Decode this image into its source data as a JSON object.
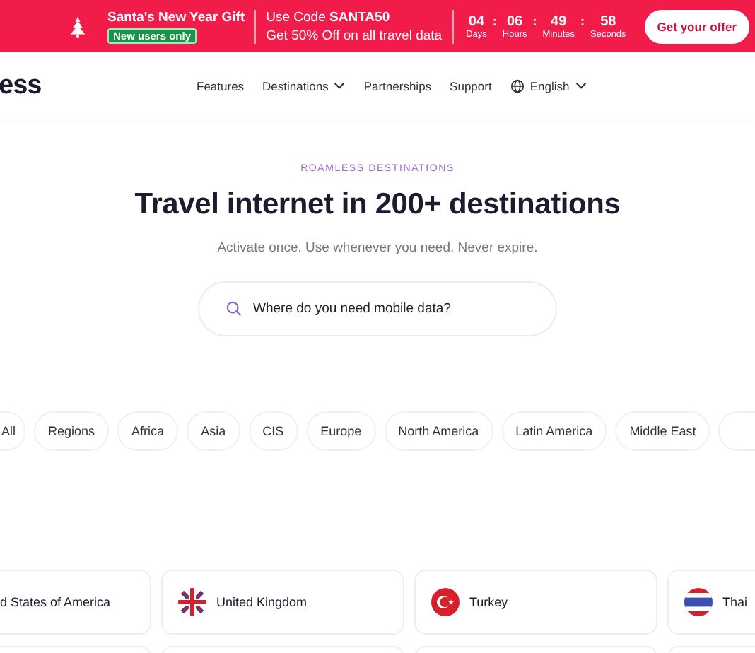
{
  "promo_banner": {
    "title": "Santa's New Year Gift",
    "badge": "New users only",
    "code_text": "Use Code **SANTA50**",
    "offer_text": "Get 50% Off on all travel data",
    "countdown": [
      {
        "value": "04",
        "unit": "Days"
      },
      {
        "value": "06",
        "unit": "Hours"
      },
      {
        "value": "49",
        "unit": "Minutes"
      },
      {
        "value": "58",
        "unit": "Seconds"
      }
    ],
    "separator": ":",
    "button": "Get your offer"
  },
  "header": {
    "logo": "ess",
    "nav": [
      {
        "label": "Features",
        "dropdown": false
      },
      {
        "label": "Destinations",
        "dropdown": true
      },
      {
        "label": "Partnerships",
        "dropdown": false
      },
      {
        "label": "Support",
        "dropdown": false
      }
    ],
    "language": "English"
  },
  "hero": {
    "eyebrow": "ROAMLESS DESTINATIONS",
    "title": "Travel internet in 200+ destinations",
    "subtitle": "Activate once. Use whenever you need. Never expire.",
    "search": {
      "placeholder": "Where do you need mobile data?"
    }
  },
  "filters": [
    "All",
    "Regions",
    "Africa",
    "Asia",
    "CIS",
    "Europe",
    "North America",
    "Latin America",
    "Middle East"
  ],
  "destinations": [
    {
      "name": "d States of America"
    },
    {
      "name": "United Kingdom",
      "kind": "uk"
    },
    {
      "name": "Turkey",
      "kind": "turkey"
    },
    {
      "name": "Thai",
      "kind": "thailand"
    }
  ]
}
